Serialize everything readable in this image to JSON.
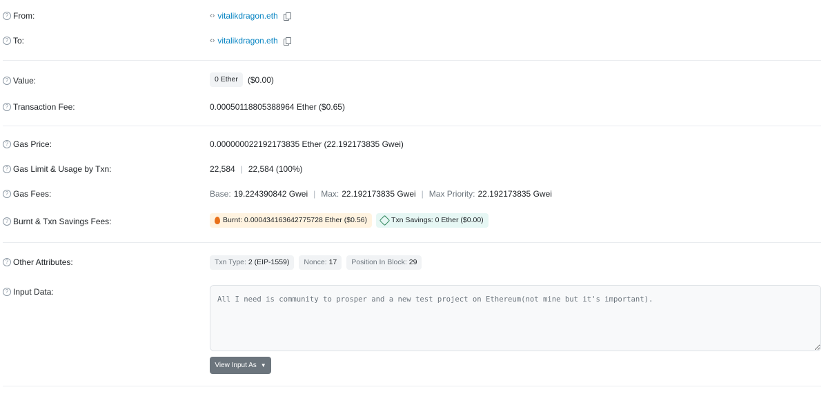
{
  "rows": {
    "from": {
      "label": "From:",
      "value": "vitalikdragon.eth"
    },
    "to": {
      "label": "To:",
      "value": "vitalikdragon.eth"
    },
    "value": {
      "label": "Value:",
      "chip": "0 Ether",
      "usd": "($0.00)"
    },
    "fee": {
      "label": "Transaction Fee:",
      "value": "0.00050118805388964 Ether ($0.65)"
    },
    "gas_price": {
      "label": "Gas Price:",
      "value": "0.000000022192173835 Ether (22.192173835 Gwei)"
    },
    "gas_limit": {
      "label": "Gas Limit & Usage by Txn:",
      "limit": "22,584",
      "sep": "|",
      "usage": "22,584 (100%)"
    },
    "gas_fees": {
      "label": "Gas Fees:",
      "base_label": "Base:",
      "base_value": "19.224390842 Gwei",
      "sep1": "|",
      "max_label": "Max:",
      "max_value": "22.192173835 Gwei",
      "sep2": "|",
      "priority_label": "Max Priority:",
      "priority_value": "22.192173835 Gwei"
    },
    "burnt": {
      "label": "Burnt & Txn Savings Fees:",
      "burnt_text": "Burnt: 0.000434163642775728 Ether ($0.56)",
      "savings_text": "Txn Savings: 0 Ether ($0.00)"
    },
    "other": {
      "label": "Other Attributes:",
      "txn_type_label": "Txn Type:",
      "txn_type_value": "2 (EIP-1559)",
      "nonce_label": "Nonce:",
      "nonce_value": "17",
      "position_label": "Position In Block:",
      "position_value": "29"
    },
    "input": {
      "label": "Input Data:",
      "value": "All I need is community to prosper and a new test project on Ethereum(not mine but it's important).",
      "button_label": "View Input As"
    }
  },
  "icons": {
    "help": "question-circle-icon",
    "copy": "copy-icon",
    "contract": "code-icon",
    "burnt": "flame-icon",
    "savings": "savings-icon"
  },
  "colors": {
    "link": "#0784c3",
    "burnt_bg": "#fff3e0",
    "savings_bg": "#e6f7f4",
    "button_bg": "#6c757d"
  }
}
